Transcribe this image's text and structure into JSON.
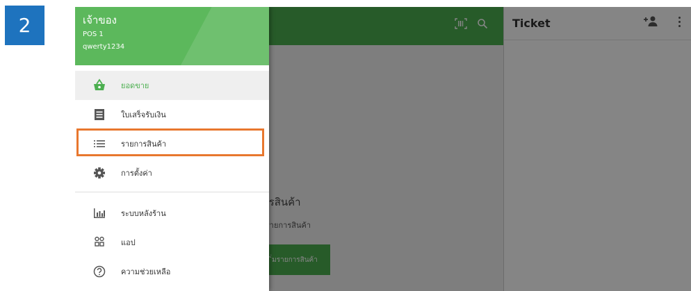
{
  "step_badge": "2",
  "drawer": {
    "owner_name": "เจ้าของ",
    "pos_name": "POS 1",
    "store_id": "qwerty1234",
    "items": [
      {
        "label": "ยอดขาย",
        "icon": "basket-icon",
        "active": true
      },
      {
        "label": "ใบเสร็จรับเงิน",
        "icon": "receipt-icon"
      },
      {
        "label": "รายการสินค้า",
        "icon": "list-icon",
        "highlighted": true
      },
      {
        "label": "การตั้งค่า",
        "icon": "gear-icon"
      },
      {
        "label": "ระบบหลังร้าน",
        "icon": "bar-chart-icon"
      },
      {
        "label": "แอป",
        "icon": "apps-icon"
      },
      {
        "label": "ความช่วยเหลือ",
        "icon": "help-icon"
      }
    ]
  },
  "main": {
    "empty_title": "มีรายการสินค้า",
    "empty_subtitle": "ารเพื่อเพิ่มรายการสินค้า",
    "empty_button": "ิ่มรายการสินค้า"
  },
  "ticket": {
    "title": "Ticket"
  },
  "colors": {
    "accent_green": "#4caf50",
    "drawer_header": "#5cb85c",
    "highlight": "#e8772e",
    "badge_blue": "#1e73be"
  }
}
